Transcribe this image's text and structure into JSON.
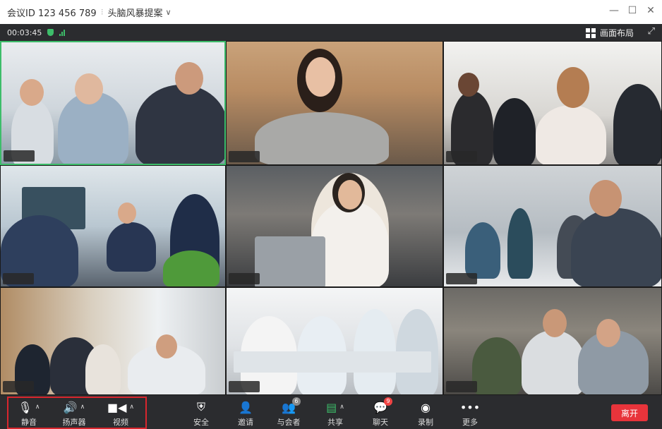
{
  "title_bar": {
    "meeting_id": "会议ID 123 456 789",
    "separator": "⁝",
    "meeting_name": "头脑风暴提案",
    "dropdown_icon": "chevron-down-icon",
    "controls": [
      "—",
      "☐",
      "✕"
    ]
  },
  "status_bar": {
    "timer": "00:03:45",
    "layout_label": "画面布局",
    "security_color": "#3dbd6a"
  },
  "toolbar": {
    "mute_label": "静音",
    "speaker_label": "扬声器",
    "video_label": "视频",
    "security_label": "安全",
    "invite_label": "邀请",
    "participants_label": "与会者",
    "participants_count": "6",
    "share_label": "共享",
    "chat_label": "聊天",
    "chat_unread": "9",
    "record_label": "录制",
    "more_label": "更多",
    "leave_label": "离开"
  },
  "colors": {
    "accent_green": "#3dbd6a",
    "leave_red": "#e8343b",
    "highlight_red": "#d8262e"
  }
}
